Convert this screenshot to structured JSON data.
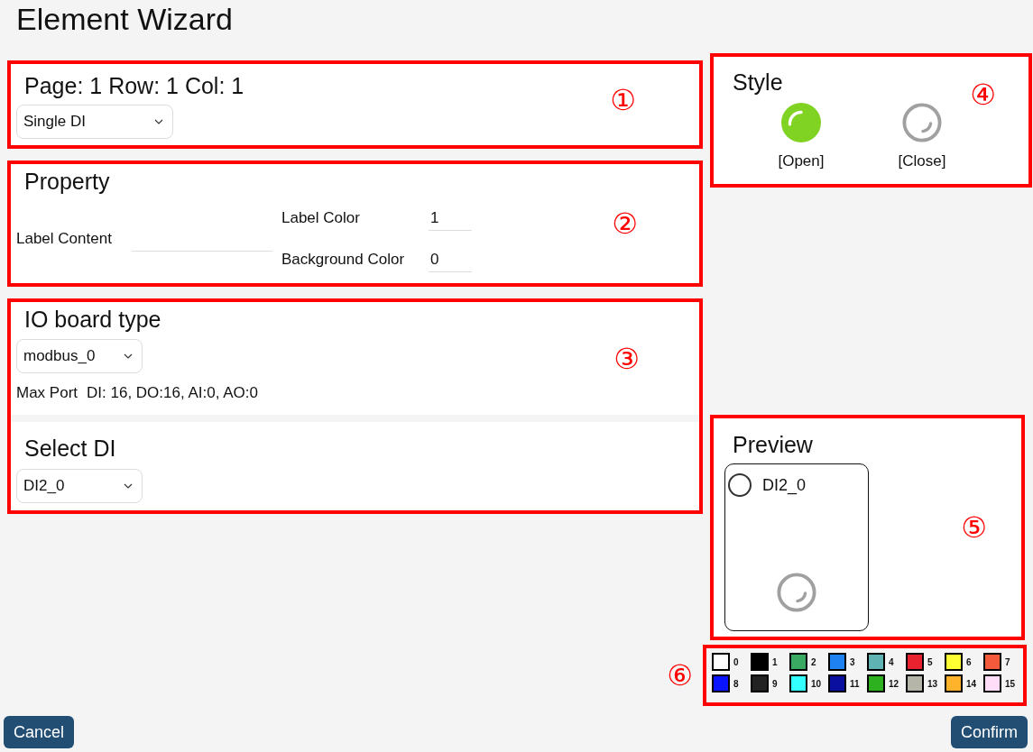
{
  "title": "Element Wizard",
  "position_panel": {
    "heading": "Page: 1 Row: 1 Col: 1",
    "element_type": {
      "value": "Single DI"
    },
    "callout": "①"
  },
  "property_panel": {
    "heading": "Property",
    "callout": "②",
    "columns": [
      [
        {
          "label": "Label Content"
        }
      ],
      [
        {
          "label": "Label Color",
          "value": "1"
        },
        {
          "label": "Background Color",
          "value": "0"
        }
      ]
    ]
  },
  "io_panel": {
    "heading": "IO board type",
    "board_type": {
      "value": "modbus_0"
    },
    "callout": "③",
    "max_port": {
      "label": "Max Port",
      "value": "DI: 16, DO:16, AI:0, AO:0"
    },
    "select_heading": "Select DI",
    "selected_di": {
      "value": "DI2_0"
    }
  },
  "style_panel": {
    "heading": "Style",
    "callout": "④",
    "options": [
      {
        "kind": "open",
        "label": "[Open]"
      },
      {
        "kind": "close",
        "label": "[Close]"
      }
    ]
  },
  "preview_panel": {
    "heading": "Preview",
    "label": "DI2_0",
    "callout": "⑤"
  },
  "palette": {
    "callout": "⑥",
    "colors": [
      {
        "label": "0",
        "color": "#ffffff"
      },
      {
        "label": "1",
        "color": "#000000"
      },
      {
        "label": "2",
        "color": "#3aaa63"
      },
      {
        "label": "3",
        "color": "#1e82f0"
      },
      {
        "label": "4",
        "color": "#5fb3b3"
      },
      {
        "label": "5",
        "color": "#e8222e"
      },
      {
        "label": "6",
        "color": "#ffff33"
      },
      {
        "label": "7",
        "color": "#f55a3c"
      },
      {
        "label": "8",
        "color": "#0a14ff"
      },
      {
        "label": "9",
        "color": "#222222"
      },
      {
        "label": "10",
        "color": "#33ffff"
      },
      {
        "label": "11",
        "color": "#0a0fa0"
      },
      {
        "label": "12",
        "color": "#2eb11e"
      },
      {
        "label": "13",
        "color": "#b5b5aa"
      },
      {
        "label": "14",
        "color": "#ffb32a"
      },
      {
        "label": "15",
        "color": "#ffddf8"
      }
    ]
  },
  "buttons": [
    {
      "label": "Cancel"
    },
    {
      "label": "Confirm"
    }
  ]
}
